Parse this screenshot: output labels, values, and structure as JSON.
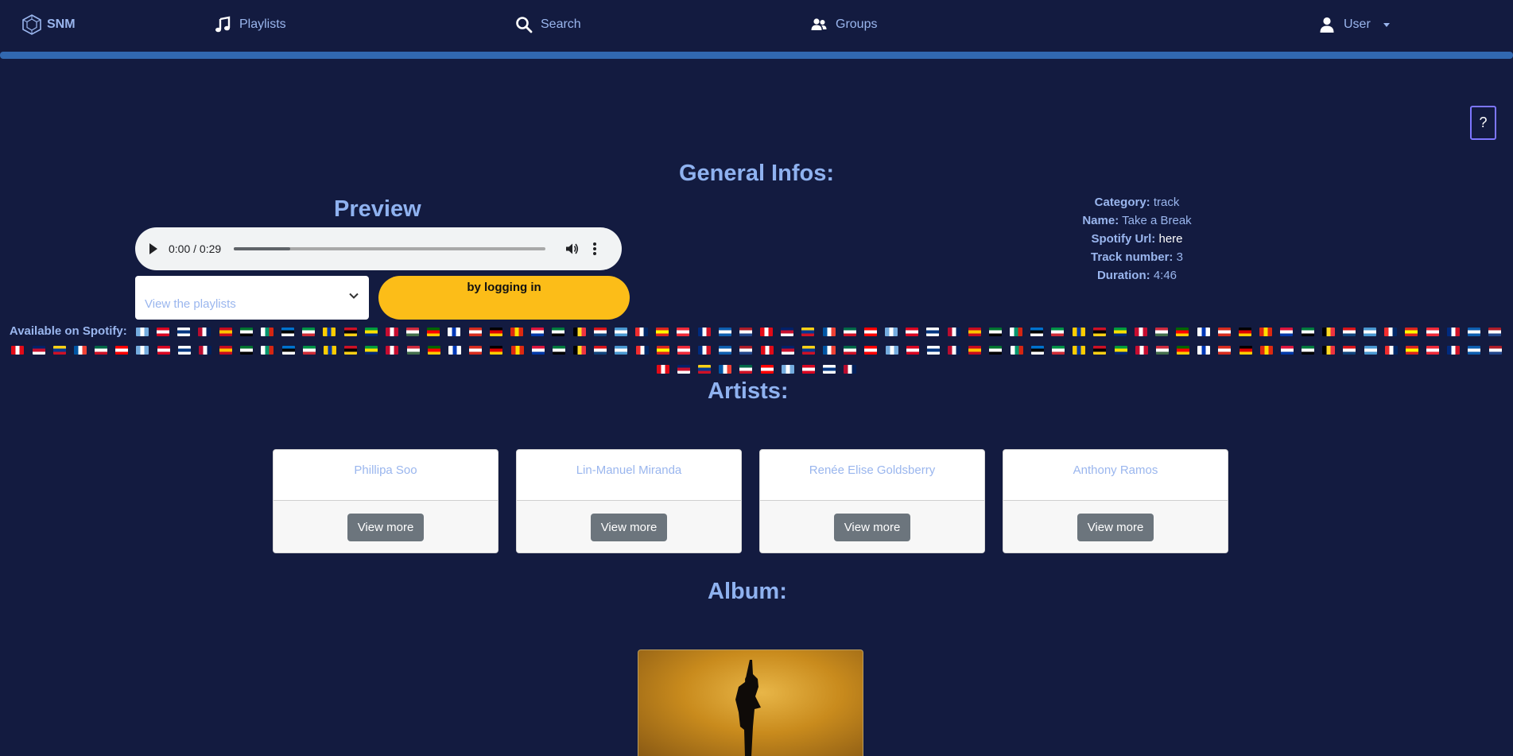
{
  "navbar": {
    "brand": "SNM",
    "playlists": "Playlists",
    "search": "Search",
    "groups": "Groups",
    "user": "User"
  },
  "help_label": "?",
  "general": {
    "heading": "General Infos:",
    "category_label": "Category:",
    "category_value": "track",
    "name_label": "Name:",
    "name_value": "Take a Break",
    "spotify_label": "Spotify Url:",
    "spotify_value": "here",
    "track_label": "Track number:",
    "track_value": "3",
    "duration_label": "Duration:",
    "duration_value": "4:46"
  },
  "preview": {
    "heading": "Preview",
    "time": "0:00 / 0:29",
    "progress": 0.18
  },
  "playlist_select": {
    "placeholder": "View the playlists"
  },
  "login_button": "by logging in",
  "availability": {
    "label": "Available on Spotify:"
  },
  "artists": {
    "heading": "Artists:",
    "items": [
      {
        "name": "Phillipa Soo",
        "button": "View more"
      },
      {
        "name": "Lin-Manuel Miranda",
        "button": "View more"
      },
      {
        "name": "Renée Elise Goldsberry",
        "button": "View more"
      },
      {
        "name": "Anthony Ramos",
        "button": "View more"
      }
    ]
  },
  "album": {
    "heading": "Album:"
  },
  "colors": {
    "background": "#131b40",
    "accent_text": "#9ab6ee",
    "nav_bar": "#3168b0",
    "login_button": "#fcbd18",
    "help_border": "#7d76ff"
  }
}
